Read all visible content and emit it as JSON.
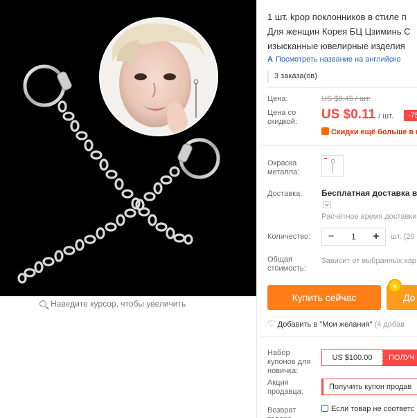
{
  "product": {
    "title_lines": [
      "1 шт. kpop поклонников в стиле п",
      "Для женщин Корея БЦ Цзиминь С",
      "изысканные ювелирные изделия"
    ],
    "translate_link": "Посмотреть название на английско",
    "translate_icon": "translate-icon",
    "orders": "3 заказа(ов)"
  },
  "gallery": {
    "zoom_hint": "Наведите курсор, чтобы увеличить",
    "zoom_icon": "magnifier-icon"
  },
  "price": {
    "label": "Цена:",
    "old_value": "US $0.45 / шт.",
    "discount_label": "Цена со скидкой:",
    "discount_value": "US $0.11",
    "unit": "/ шт.",
    "discount_badge": "-75",
    "promo_text": "Скидки ещё больше в п",
    "accent_color": "#ff4747"
  },
  "options": {
    "metal_label": "Окраска металла:"
  },
  "shipping": {
    "label": "Доставка:",
    "value": "Бесплатная доставка в R",
    "estimate": "Расчётное время доставки"
  },
  "quantity": {
    "label": "Количество:",
    "value": "1",
    "minus": "−",
    "plus": "+",
    "unit": "шт. (20"
  },
  "total": {
    "label": "Общая стоимость:",
    "value": "Зависит от выбранных хар"
  },
  "actions": {
    "buy_now": "Купить сейчас",
    "add_to_cart": "До",
    "buy_color": "#ff7e1a",
    "cart_color": "#ff9c1f"
  },
  "wishlist": {
    "label": "Добавить в \"Мои желания\"",
    "count": "(4 добав"
  },
  "coupons": {
    "newbie_label": "Набор купонов для новичка:",
    "newbie_amount": "US $100.00",
    "newbie_get": "ПОЛУЧ",
    "seller_label": "Акция продавца:",
    "seller_text": "Получить купон продав"
  },
  "returns": {
    "label": "Возврат товара",
    "value": "Если товар не соответс"
  }
}
